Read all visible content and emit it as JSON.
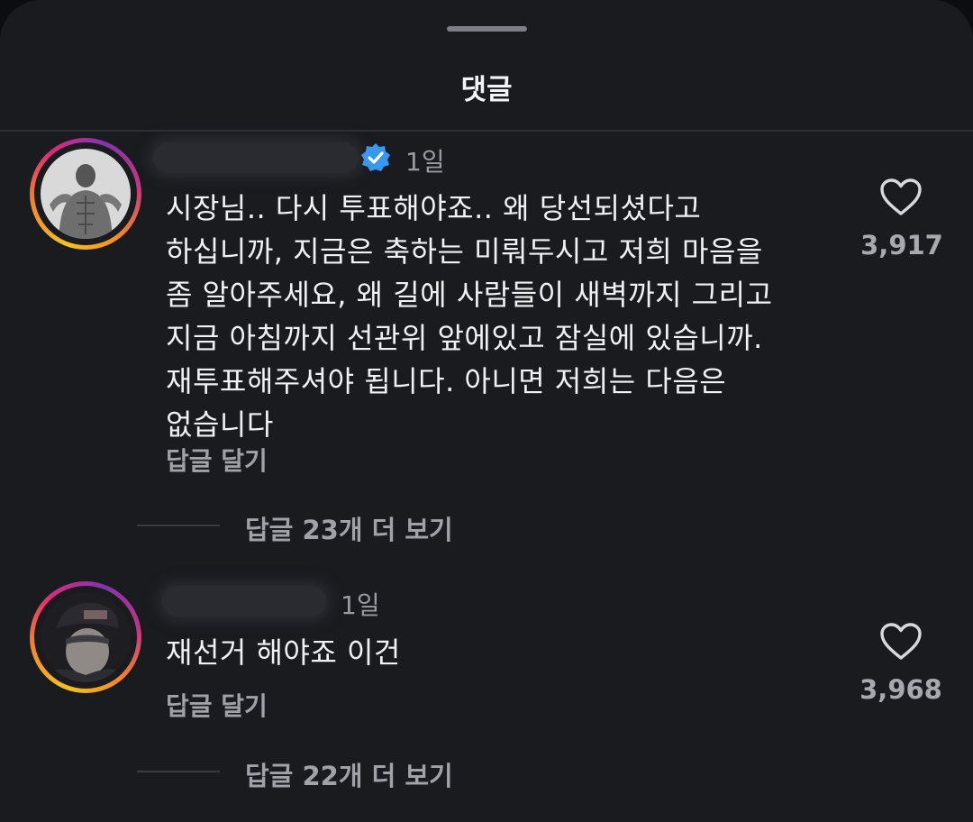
{
  "header": {
    "title": "댓글"
  },
  "comments": [
    {
      "time": "1일",
      "verified": true,
      "text": "시장님.. 다시 투표해야죠.. 왜 당선되셨다고\n하십니까, 지금은 축하는 미뤄두시고 저희 마음을\n좀 알아주세요, 왜 길에 사람들이 새벽까지 그리고\n지금 아침까지 선관위 앞에있고 잠실에 있습니까.\n재투표해주셔야 됩니다. 아니면 저희는 다음은\n없습니다",
      "reply_label": "답글 달기",
      "likes": "3,917",
      "more_replies": "답글 23개 더 보기"
    },
    {
      "time": "1일",
      "verified": false,
      "text": "재선거 해야죠 이건",
      "reply_label": "답글 달기",
      "likes": "3,968",
      "more_replies": "답글 22개 더 보기"
    }
  ],
  "colors": {
    "background": "#1a1b1f",
    "text": "#f1f1f3",
    "secondary_text": "#a0a2a8",
    "verified_badge": "#3897f0"
  },
  "icons": {
    "like": "heart-outline-icon",
    "verified": "verified-badge-icon"
  }
}
